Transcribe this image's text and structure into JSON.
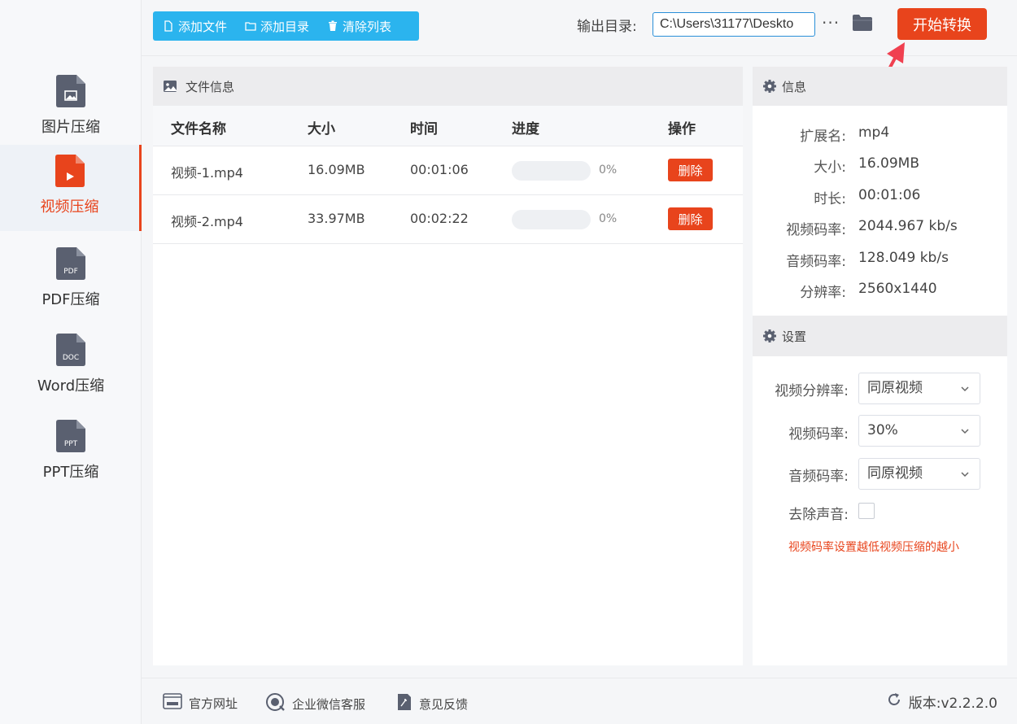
{
  "sidebar": {
    "items": [
      {
        "label": "图片压缩",
        "tag": "",
        "active": false
      },
      {
        "label": "视频压缩",
        "tag": "",
        "active": true
      },
      {
        "label": "PDF压缩",
        "tag": "PDF",
        "active": false
      },
      {
        "label": "Word压缩",
        "tag": "DOC",
        "active": false
      },
      {
        "label": "PPT压缩",
        "tag": "PPT",
        "active": false
      }
    ]
  },
  "toolbar": {
    "add_file": "添加文件",
    "add_folder": "添加目录",
    "clear_list": "清除列表",
    "output_label": "输出目录:",
    "output_path": "C:\\Users\\31177\\Deskto",
    "more": "···",
    "start": "开始转换"
  },
  "file_panel": {
    "title": "文件信息",
    "columns": [
      "文件名称",
      "大小",
      "时间",
      "进度",
      "操作"
    ],
    "rows": [
      {
        "name": "视频-1.mp4",
        "size": "16.09MB",
        "time": "00:01:06",
        "progress": 0,
        "pct": "0%",
        "action": "删除"
      },
      {
        "name": "视频-2.mp4",
        "size": "33.97MB",
        "time": "00:02:22",
        "progress": 0,
        "pct": "0%",
        "action": "删除"
      }
    ]
  },
  "info": {
    "title": "信息",
    "rows": [
      {
        "label": "扩展名:",
        "value": "mp4"
      },
      {
        "label": "大小:",
        "value": "16.09MB"
      },
      {
        "label": "时长:",
        "value": "00:01:06"
      },
      {
        "label": "视频码率:",
        "value": "2044.967 kb/s"
      },
      {
        "label": "音频码率:",
        "value": "128.049 kb/s"
      },
      {
        "label": "分辨率:",
        "value": "2560x1440"
      }
    ]
  },
  "settings": {
    "title": "设置",
    "video_res_label": "视频分辨率:",
    "video_res_value": "同原视频",
    "video_bitrate_label": "视频码率:",
    "video_bitrate_value": "30%",
    "audio_bitrate_label": "音频码率:",
    "audio_bitrate_value": "同原视频",
    "remove_audio_label": "去除声音:",
    "remove_audio_checked": false,
    "hint": "视频码率设置越低视频压缩的越小"
  },
  "footer": {
    "website": "官方网址",
    "wechat": "企业微信客服",
    "feedback": "意见反馈",
    "version": "版本:v2.2.2.0"
  },
  "colors": {
    "accent": "#e8441c",
    "toolbar_blue": "#2bb4ee",
    "icon_gray": "#5a6070"
  }
}
